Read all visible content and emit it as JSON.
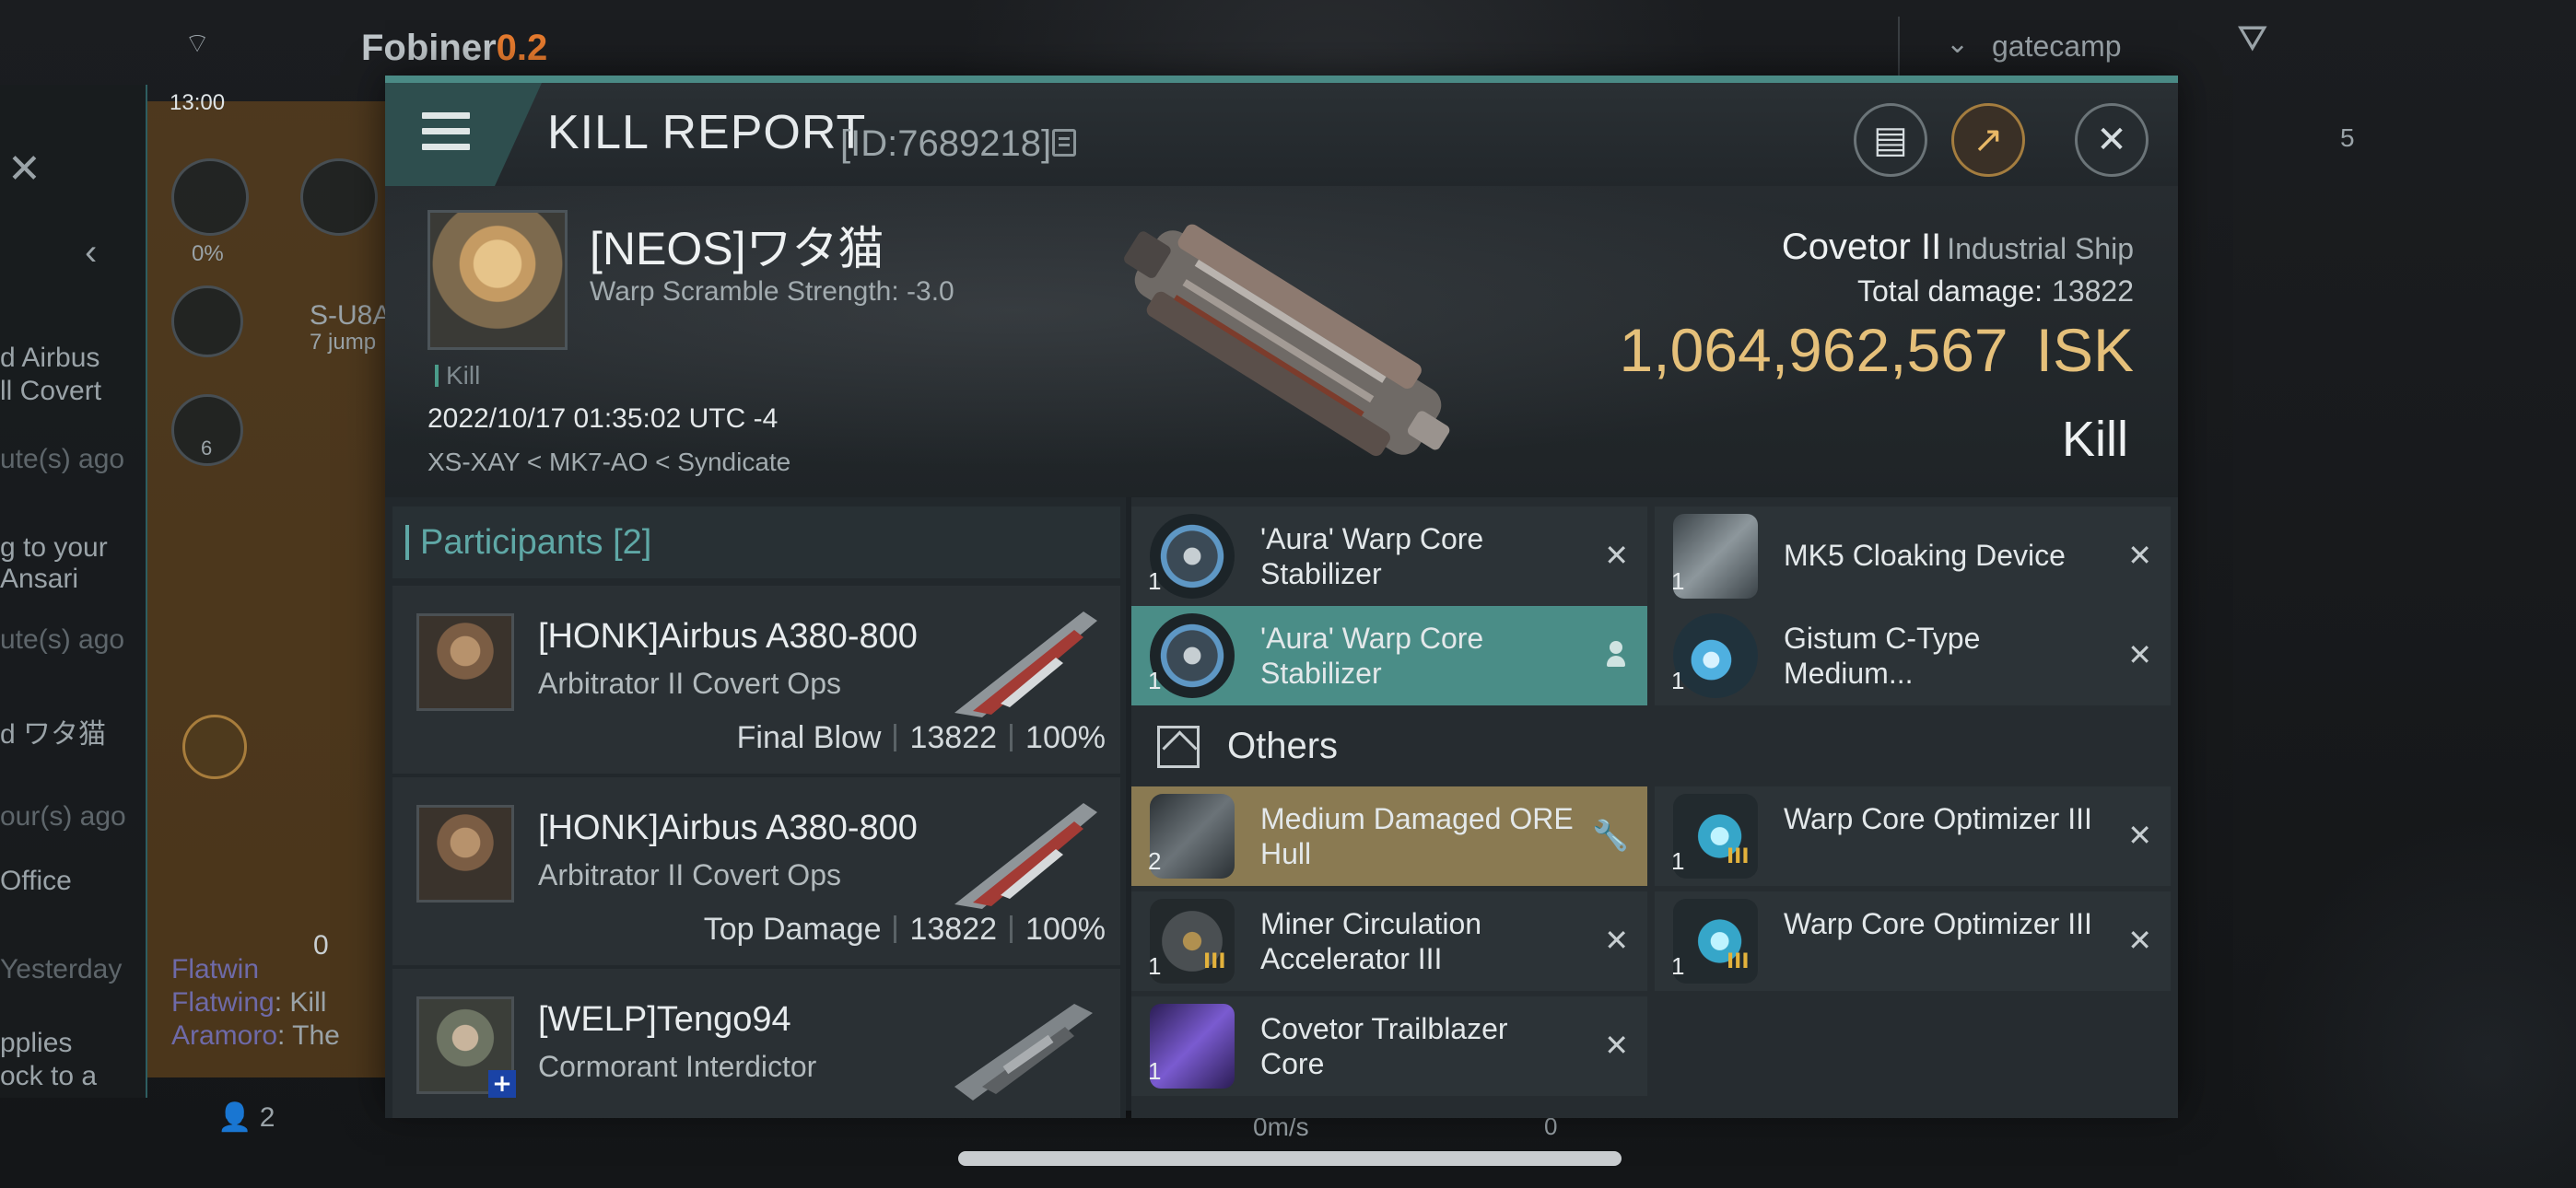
{
  "background": {
    "pilot_name": "Fobiner",
    "security": "0.2",
    "time": "13:00",
    "percent": "0%",
    "route_system": "S-U8A",
    "route_jumps": "7 jump",
    "filter_value": "gatecamp",
    "channel_count": "0",
    "side_text": [
      "d Airbus",
      "ll Covert",
      "ute(s) ago",
      "g to your",
      "Ansari",
      "ute(s) ago",
      "d ワタ猫",
      "our(s) ago",
      "Office",
      "Yesterday",
      "pplies",
      "ock to a"
    ],
    "chat": [
      "Flatwin",
      "Flatwing",
      ": Kill",
      "Aramoro",
      ": The"
    ],
    "people_count": "2",
    "overview_count": "5",
    "speed": "0m/s",
    "bottom_zero": "0",
    "fleet_number": "6"
  },
  "header": {
    "title": "KILL REPORT",
    "report_id": "[ID:7689218]"
  },
  "victim": {
    "name": "[NEOS]ワタ猫",
    "warp_scramble": "Warp Scramble Strength: -3.0",
    "kill_tag": "Kill",
    "datetime": "2022/10/17 01:35:02 UTC -4",
    "location": "XS-XAY < MK7-AO < Syndicate",
    "ship_name": "Covetor II",
    "ship_class": "Industrial Ship",
    "total_damage_label": "Total damage:",
    "total_damage_value": "13822",
    "isk_value": "1,064,962,567",
    "isk_unit": "ISK",
    "result": "Kill"
  },
  "participants": {
    "label": "Participants [2]",
    "rows": [
      {
        "name": "[HONK]Airbus A380-800",
        "ship": "Arbitrator II Covert Ops",
        "role": "Final Blow",
        "damage": "13822",
        "percent": "100%"
      },
      {
        "name": "[HONK]Airbus A380-800",
        "ship": "Arbitrator II Covert Ops",
        "role": "Top Damage",
        "damage": "13822",
        "percent": "100%"
      },
      {
        "name": "[WELP]Tengo94",
        "ship": "Cormorant Interdictor",
        "role": "",
        "damage": "",
        "percent": ""
      }
    ]
  },
  "items": {
    "others_label": "Others",
    "list": [
      {
        "qty": "1",
        "name": "'Aura' Warp Core Stabilizer",
        "tier": ""
      },
      {
        "qty": "1",
        "name": "MK5 Cloaking Device",
        "tier": ""
      },
      {
        "qty": "1",
        "name": "'Aura' Warp Core Stabilizer",
        "tier": ""
      },
      {
        "qty": "1",
        "name": "Gistum C-Type Medium...",
        "tier": ""
      },
      {
        "qty": "2",
        "name": "Medium Damaged ORE Hull",
        "tier": ""
      },
      {
        "qty": "1",
        "name": "Warp Core Optimizer III",
        "tier": "III"
      },
      {
        "qty": "1",
        "name": "Miner Circulation Accelerator III",
        "tier": "III"
      },
      {
        "qty": "1",
        "name": "Warp Core Optimizer III",
        "tier": "III"
      },
      {
        "qty": "1",
        "name": "Covetor Trailblazer Core",
        "tier": ""
      }
    ]
  },
  "icons": {
    "close": "close-icon",
    "menu": "menu-icon",
    "document": "document-icon",
    "share": "share-icon",
    "remove": "remove-icon",
    "person": "person-icon",
    "wrench": "wrench-icon",
    "box": "box-icon"
  },
  "colors": {
    "accent_teal": "#4a8a85",
    "isk_gold": "#e5c07a",
    "highlight_teal": "#4a8d87",
    "highlight_gold": "#8a7a52"
  }
}
